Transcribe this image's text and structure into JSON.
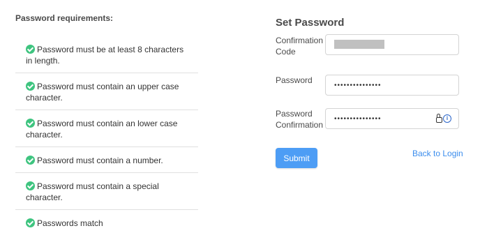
{
  "requirements": {
    "title": "Password requirements:",
    "items": [
      "Password must be at least 8 characters in length.",
      "Password must contain an upper case character.",
      "Password must contain an lower case character.",
      "Password must contain a number.",
      "Password must contain a special character.",
      "Passwords match"
    ],
    "check_color": "#3ec47f"
  },
  "form": {
    "title": "Set Password",
    "confirmation_code_label": "Confirmation Code",
    "password_label": "Password",
    "password_value": "•••••••••••••••",
    "password_confirmation_label": "Password Confirmation",
    "password_confirmation_value": "•••••••••••••••",
    "password_manager_icon": "lock-info-icon",
    "submit_label": "Submit",
    "back_link": "Back to Login",
    "accent_color": "#4d9df5"
  }
}
